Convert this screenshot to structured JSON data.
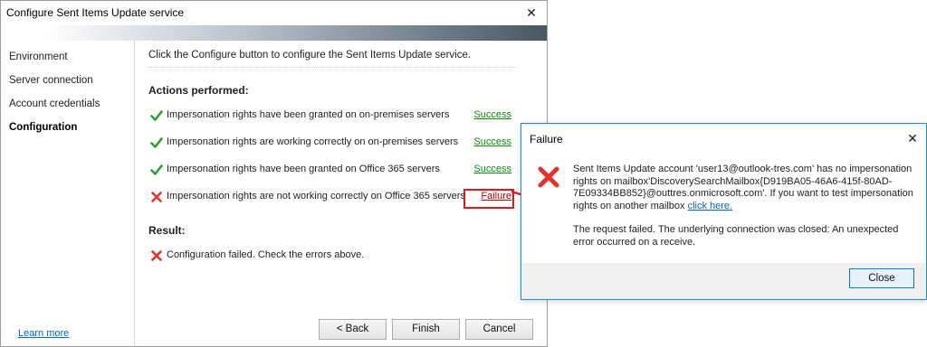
{
  "wizard": {
    "title": "Configure Sent Items Update service",
    "close_glyph": "✕",
    "nav": [
      {
        "label": "Environment"
      },
      {
        "label": "Server connection"
      },
      {
        "label": "Account credentials"
      },
      {
        "label": "Configuration"
      }
    ],
    "learn_more": "Learn more",
    "intro": "Click the Configure button to configure the Sent Items Update service.",
    "actions_heading": "Actions performed:",
    "actions": [
      {
        "text": "Impersonation rights have been granted on on-premises servers",
        "status": "Success",
        "icon": "check-icon"
      },
      {
        "text": "Impersonation rights are working correctly on on-premises servers",
        "status": "Success",
        "icon": "check-icon"
      },
      {
        "text": "Impersonation rights have been granted on Office 365 servers",
        "status": "Success",
        "icon": "check-icon"
      },
      {
        "text": "Impersonation rights are not working correctly on Office 365 servers",
        "status": "Failure",
        "icon": "cross-icon"
      }
    ],
    "result_heading": "Result:",
    "result_text": "Configuration failed. Check the errors above.",
    "buttons": {
      "back": "< Back",
      "finish": "Finish",
      "cancel": "Cancel"
    }
  },
  "dialog": {
    "title": "Failure",
    "close_glyph": "✕",
    "message1": "Sent Items Update account 'user13@outlook-tres.com' has no impersonation rights on mailbox'DiscoverySearchMailbox{D919BA05-46A6-415f-80AD-7E09334BB852}@outtres.onmicrosoft.com'. If you want to test impersonation rights on another mailbox ",
    "link": "click here.",
    "message2": "The request failed. The underlying connection was closed: An unexpected error occurred on a receive.",
    "close_button": "Close"
  },
  "colors": {
    "success": "#118a11",
    "failure": "#b00000",
    "highlight": "#e0181e",
    "link": "#0066cc",
    "dialog_border": "#1a8fd8"
  }
}
